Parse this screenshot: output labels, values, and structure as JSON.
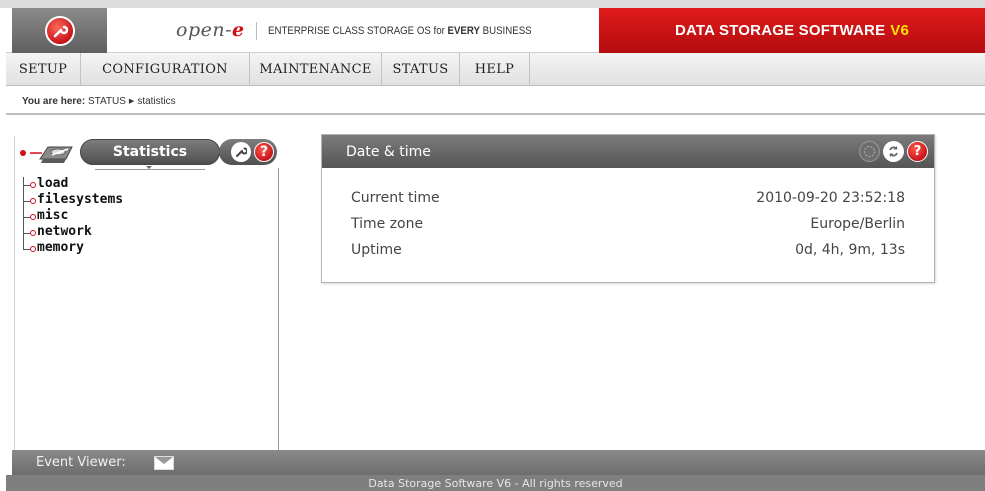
{
  "header": {
    "brand_name": "open-",
    "brand_suffix": "e",
    "slogan_prefix": "ENTERPRISE CLASS STORAGE OS for",
    "slogan_bold": "EVERY",
    "slogan_suffix": "BUSINESS",
    "banner_text": "DATA STORAGE SOFTWARE",
    "banner_version": "V6"
  },
  "menu": {
    "items": [
      {
        "label": "SETUP"
      },
      {
        "label": "CONFIGURATION"
      },
      {
        "label": "MAINTENANCE"
      },
      {
        "label": "STATUS"
      },
      {
        "label": "HELP"
      }
    ]
  },
  "breadcrumb": {
    "prefix": "You are here:",
    "section": "STATUS",
    "page": "statistics"
  },
  "sidebar": {
    "title": "Statistics",
    "items": [
      {
        "label": "load"
      },
      {
        "label": "filesystems"
      },
      {
        "label": "misc"
      },
      {
        "label": "network"
      },
      {
        "label": "memory"
      }
    ]
  },
  "datetime_box": {
    "title": "Date & time",
    "rows": [
      {
        "label": "Current time",
        "value": "2010-09-20 23:52:18"
      },
      {
        "label": "Time zone",
        "value": "Europe/Berlin"
      },
      {
        "label": "Uptime",
        "value": "0d, 4h, 9m, 13s"
      }
    ]
  },
  "event_viewer": {
    "label": "Event Viewer:"
  },
  "footer": {
    "text": "Data Storage Software V6 - All rights reserved"
  },
  "colors": {
    "brand_red": "#d40f14",
    "version_yellow": "#ffe200",
    "panel_gray": "#5f5f5f"
  },
  "icons": {
    "logo": "wrench-logo-icon",
    "sidebar": "hard-disk-icon",
    "tools": "wrench-icon",
    "help": "help-icon",
    "refresh": "refresh-icon",
    "reload": "reload-icon",
    "mail": "mail-icon"
  }
}
